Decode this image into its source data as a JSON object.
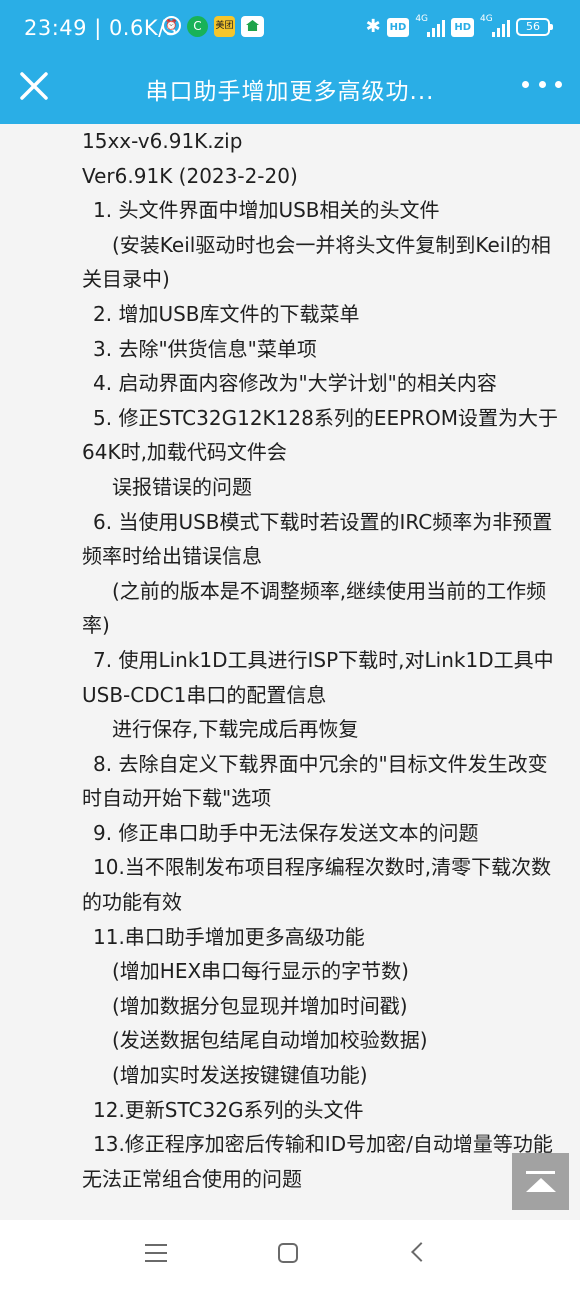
{
  "status_bar": {
    "time_speed": "23:49 | 0.6K/s",
    "app_icon_green": "C",
    "app_icon_yellow": "美团",
    "hd_label": "HD",
    "network_label": "4G",
    "battery_level": "56"
  },
  "title_bar": {
    "title": "串口助手增加更多高级功..."
  },
  "content": {
    "lines": [
      "15xx-v6.91K.zip",
      "Ver6.91K (2023-2-20)",
      "1. 头文件界面中增加USB相关的头文件",
      "(安装Keil驱动时也会一并将头文件复制到Keil的相关目录中)",
      "2. 增加USB库文件的下载菜单",
      "3. 去除\"供货信息\"菜单项",
      "4. 启动界面内容修改为\"大学计划\"的相关内容",
      "5. 修正STC32G12K128系列的EEPROM设置为大于64K时,加载代码文件会",
      "误报错误的问题",
      "6. 当使用USB模式下载时若设置的IRC频率为非预置频率时给出错误信息",
      "(之前的版本是不调整频率,继续使用当前的工作频率)",
      "7. 使用Link1D工具进行ISP下载时,对Link1D工具中USB-CDC1串口的配置信息",
      "进行保存,下载完成后再恢复",
      "8. 去除自定义下载界面中冗余的\"目标文件发生改变时自动开始下载\"选项",
      "9. 修正串口助手中无法保存发送文本的问题",
      "10.当不限制发布项目程序编程次数时,清零下载次数的功能有效",
      "11.串口助手增加更多高级功能",
      "(增加HEX串口每行显示的字节数)",
      "(增加数据分包显现并增加时间戳)",
      "(发送数据包结尾自动增加校验数据)",
      "(增加实时发送按键键值功能)",
      "12.更新STC32G系列的头文件",
      "13.修正程序加密后传输和ID号加密/自动增量等功能无法正常组合使用的问题"
    ]
  },
  "colors": {
    "header": "#2aaee6",
    "background": "#f4f4f4",
    "text": "#1f1f1f"
  }
}
